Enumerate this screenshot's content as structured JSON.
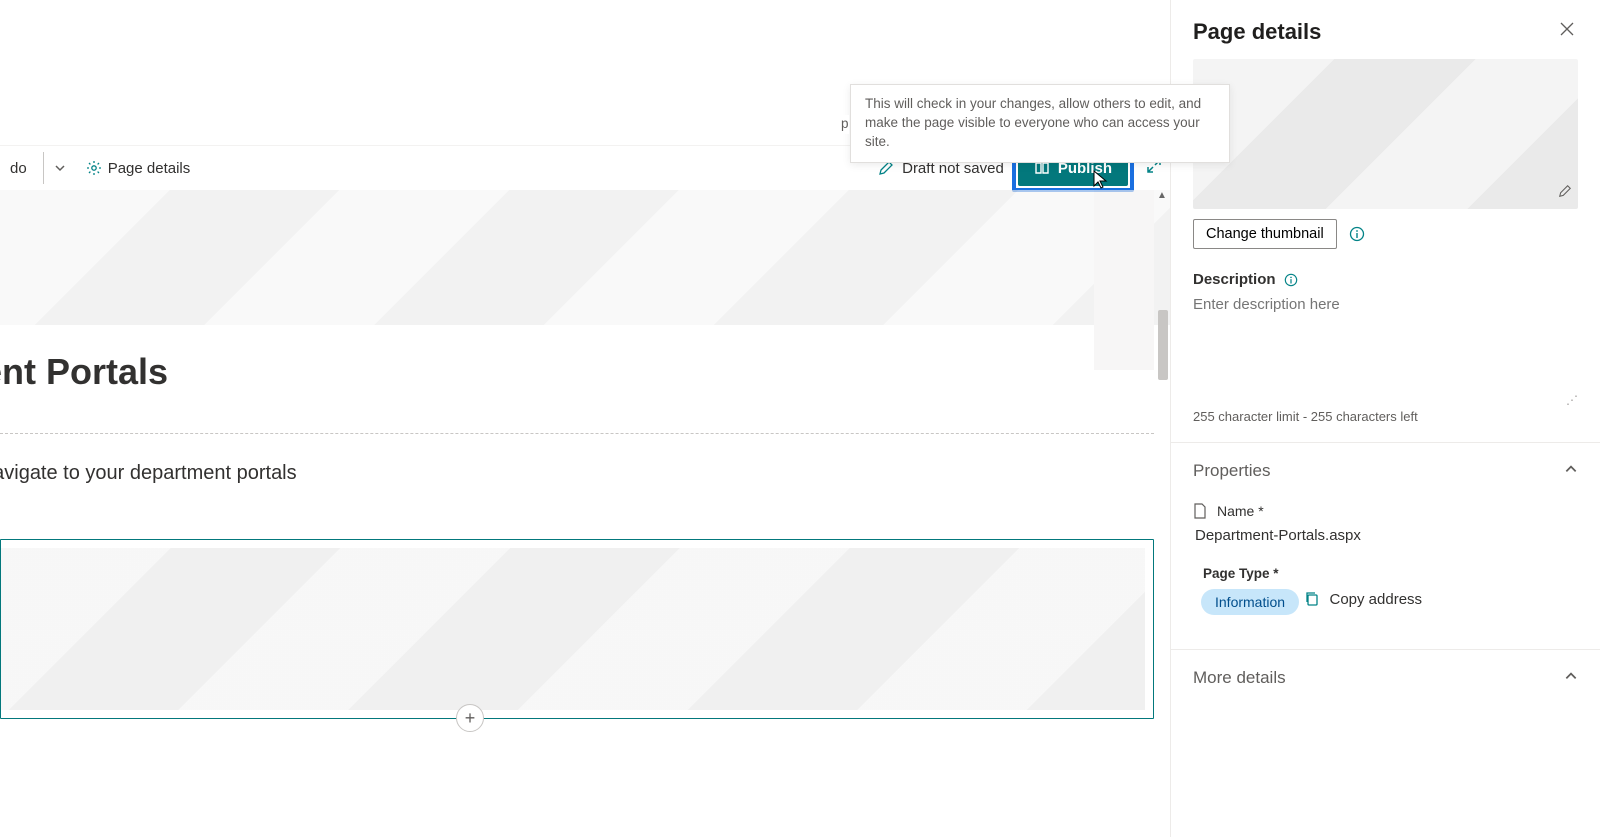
{
  "commandBar": {
    "undo_suffix": "do",
    "page_details_label": "Page details",
    "draft_status": "Draft not saved",
    "publish_label": "Publish"
  },
  "tooltip": {
    "leading_char": "p",
    "text": "This will check in your changes, allow others to edit, and make the page visible to everyone who can access your site."
  },
  "page": {
    "title_fragment": "ent Portals",
    "subtitle_fragment": "navigate to your department portals"
  },
  "panel": {
    "title": "Page details",
    "change_thumbnail": "Change thumbnail",
    "description_label": "Description",
    "description_placeholder": "Enter description here",
    "char_limit_text": "255 character limit - 255 characters left",
    "properties_header": "Properties",
    "name_label": "Name *",
    "name_value": "Department-Portals.aspx",
    "page_type_label": "Page Type *",
    "page_type_value": "Information",
    "copy_address": "Copy address",
    "more_details_header": "More details"
  },
  "colors": {
    "accent": "#03787c",
    "highlight": "#1a6fe0",
    "pill_bg": "#c7e6fa",
    "pill_fg": "#004e8c"
  }
}
